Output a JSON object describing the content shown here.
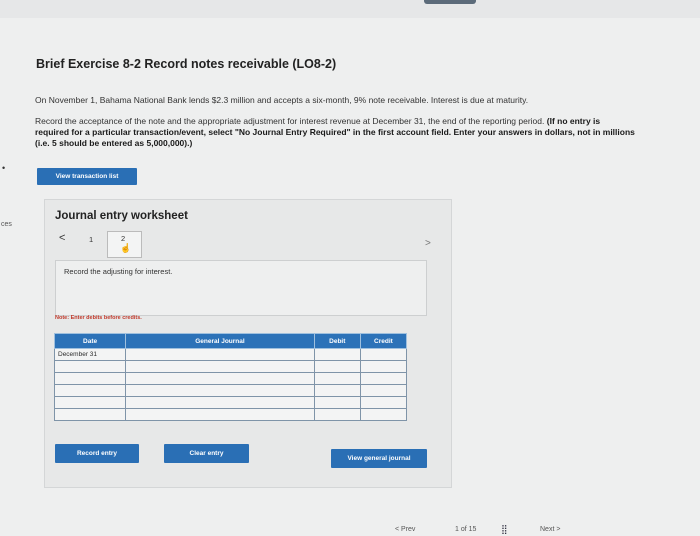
{
  "left_edge": {
    "mark": "•",
    "text": "ces"
  },
  "exercise": {
    "title": "Brief Exercise 8-2 Record notes receivable (LO8-2)",
    "paragraph1": "On November 1, Bahama National Bank lends $2.3 million and accepts a six-month, 9% note receivable. Interest is due at maturity.",
    "paragraph2_normal": "Record the acceptance of the note and the appropriate adjustment for interest revenue at December 31, the end of the reporting period. ",
    "paragraph2_bold": "(If no entry is required for a particular transaction/event, select \"No Journal Entry Required\" in the first account field. Enter your answers in dollars, not in millions (i.e. 5 should be entered as 5,000,000).)"
  },
  "view_list_button": "View transaction list",
  "worksheet": {
    "title": "Journal entry worksheet",
    "prev_arrow": "<",
    "page1": "1",
    "page2": "2",
    "next_arrow": ">",
    "description": "Record the adjusting for interest.",
    "note": "Note: Enter debits before credits.",
    "table": {
      "headers": {
        "date": "Date",
        "general": "General Journal",
        "debit": "Debit",
        "credit": "Credit"
      },
      "first_date": "December 31",
      "row_count": 6
    },
    "buttons": {
      "record": "Record entry",
      "clear": "Clear entry",
      "view_general": "View general journal"
    }
  },
  "footer": {
    "prev": "< Prev",
    "page": "1 of 15",
    "next": "Next >"
  },
  "icons": {
    "hand": "hand-pointer-icon",
    "grid": "grid-icon"
  },
  "colors": {
    "accent": "#2a6fb5",
    "note": "#c0392b",
    "background": "#eeefef"
  }
}
